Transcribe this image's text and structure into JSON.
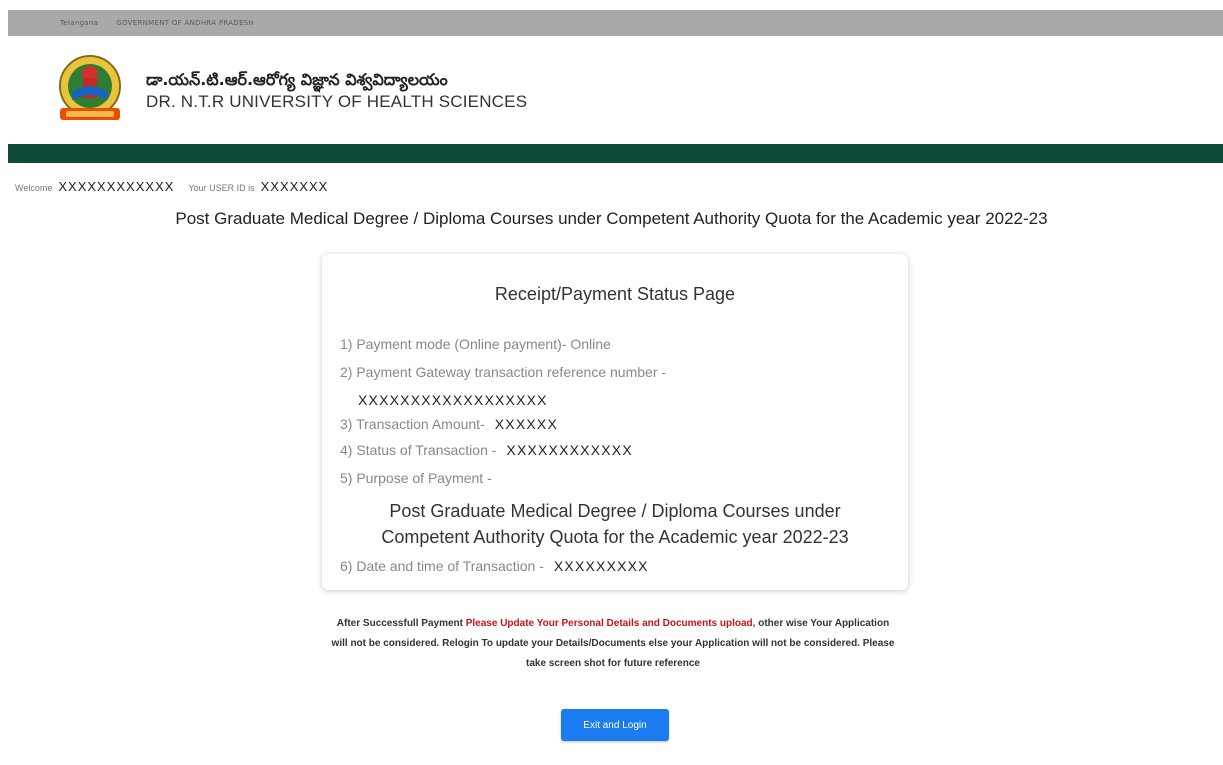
{
  "topbar": {
    "links": [
      "Telangana",
      "GOVERNMENT OF ANDHRA PRADESH"
    ]
  },
  "header": {
    "university_telugu": "డా.యన్.టి.ఆర్.ఆరోగ్య విజ్ఞాన విశ్వవిద్యాలయం",
    "university_english": "DR. N.T.R UNIVERSITY OF HEALTH SCIENCES"
  },
  "welcome": {
    "label": "Welcome",
    "name": "XXXXXXXXXXXX",
    "userid_label": "Your USER ID is",
    "userid": "XXXXXXX"
  },
  "page_heading": "Post Graduate Medical Degree / Diploma Courses under Competent Authority Quota for the Academic year 2022-23",
  "receipt": {
    "title": "Receipt/Payment Status Page",
    "payment_mode_label": "1) Payment mode (Online payment)- Online",
    "gateway_ref_label": "2) Payment Gateway transaction reference number -",
    "gateway_ref_value": "XXXXXXXXXXXXXXXXXX",
    "amount_label": "3) Transaction Amount-",
    "amount_value": "XXXXXX",
    "status_label": "4) Status of Transaction -",
    "status_value": "XXXXXXXXXXXX",
    "purpose_label": "5) Purpose of Payment -",
    "purpose_line1": "Post Graduate Medical Degree / Diploma Courses under",
    "purpose_line2": "Competent Authority Quota for the Academic year 2022-23",
    "datetime_label": "6) Date and time of Transaction -",
    "datetime_value": "XXXXXXXXX"
  },
  "notice": {
    "prefix": "After Successfull Payment ",
    "highlight": "Please Update Your Personal Details and Documents upload,",
    "rest": " other wise Your Application will not be considered. Relogin To update your Details/Documents else your Application will not be considered. Please take screen shot for future reference",
    "highlight_color": "#c3141b"
  },
  "exit_button_label": "Exit and Login"
}
